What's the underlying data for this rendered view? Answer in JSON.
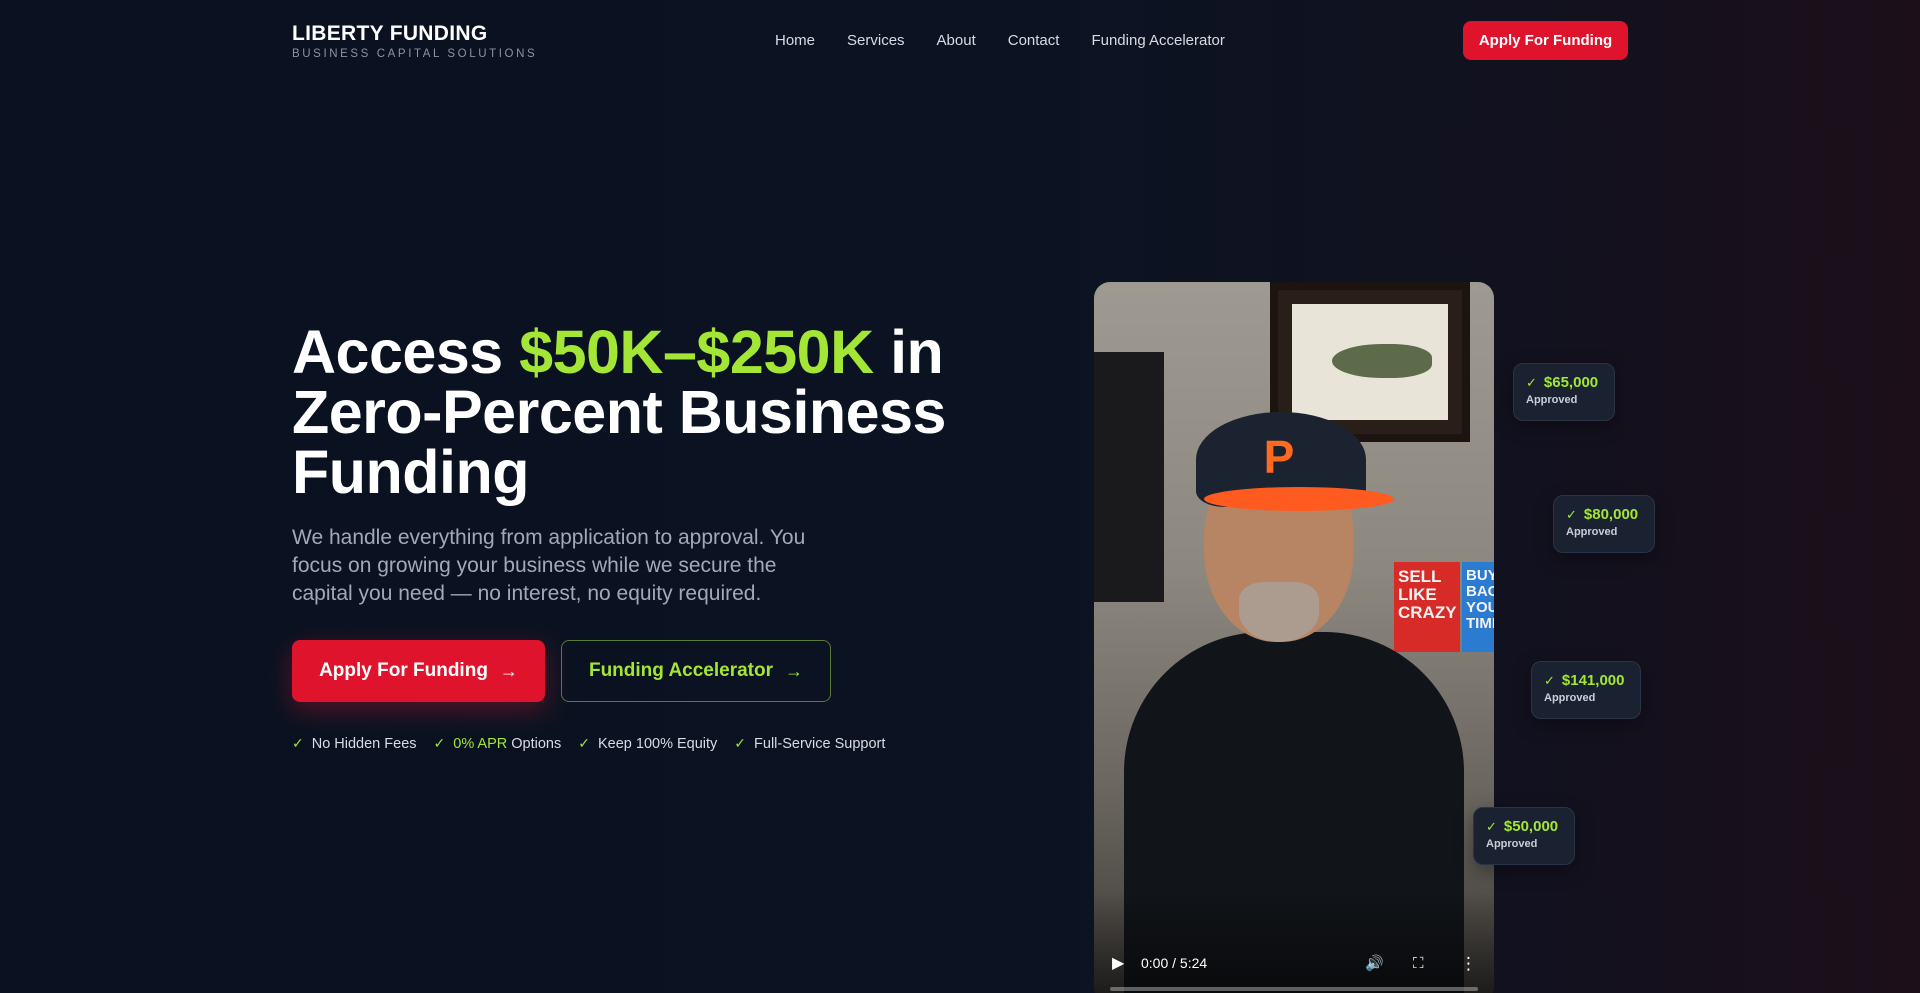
{
  "brand": {
    "name": "LIBERTY FUNDING",
    "tagline": "BUSINESS CAPITAL SOLUTIONS"
  },
  "nav": {
    "items": [
      {
        "label": "Home"
      },
      {
        "label": "Services"
      },
      {
        "label": "About"
      },
      {
        "label": "Contact"
      },
      {
        "label": "Funding Accelerator"
      }
    ],
    "cta_label": "Apply For Funding"
  },
  "hero": {
    "headline_pre": "Access ",
    "headline_accent": "$50K–$250K",
    "headline_post": " in Zero-Percent Business Funding",
    "subtext": "We handle everything from application to approval. You focus on growing your business while we secure the capital you need — no interest, no equity required.",
    "primary_cta": "Apply For Funding",
    "secondary_cta": "Funding Accelerator",
    "features": [
      {
        "label": "No Hidden Fees"
      },
      {
        "highlight": "0% APR",
        "label": " Options"
      },
      {
        "label": "Keep 100% Equity"
      },
      {
        "label": "Full-Service Support"
      }
    ]
  },
  "video": {
    "time": "0:00 / 5:24",
    "progress": 0,
    "cap_letter": "P",
    "book_red_text": "SELL LIKE CRAZY",
    "book_blue_text": "BUY BACK YOUR TIME"
  },
  "badges": [
    {
      "amount": "$65,000",
      "status": "Approved"
    },
    {
      "amount": "$80,000",
      "status": "Approved"
    },
    {
      "amount": "$141,000",
      "status": "Approved"
    },
    {
      "amount": "$50,000",
      "status": "Approved"
    }
  ],
  "colors": {
    "accent_green": "#a3e635",
    "accent_red": "#e0132d",
    "background": "#0b1322"
  },
  "icons": {
    "check": "check-icon",
    "arrow": "arrow-right-icon",
    "play": "play-icon",
    "volume": "volume-icon",
    "fullscreen": "fullscreen-icon",
    "more": "more-vertical-icon"
  }
}
